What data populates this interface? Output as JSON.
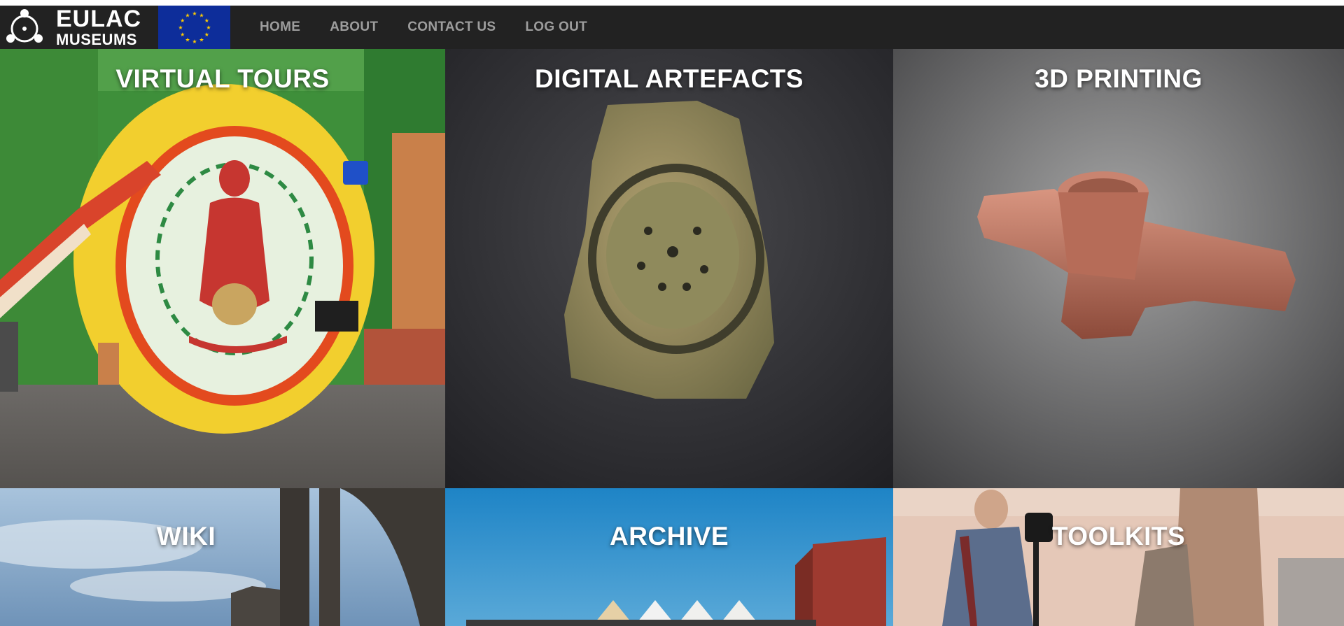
{
  "brand": {
    "line1": "EULAC",
    "line2": "MUSEUMS"
  },
  "nav": {
    "items": [
      {
        "label": "HOME"
      },
      {
        "label": "ABOUT"
      },
      {
        "label": "CONTACT US"
      },
      {
        "label": "LOG OUT"
      }
    ]
  },
  "tiles": [
    {
      "title": "VIRTUAL TOURS",
      "image": "mural-painting-image"
    },
    {
      "title": "DIGITAL ARTEFACTS",
      "image": "carved-stone-artefact-image"
    },
    {
      "title": "3D PRINTING",
      "image": "clay-pipe-3d-model-image"
    },
    {
      "title": "WIKI",
      "image": "cathedral-ruins-image"
    },
    {
      "title": "ARCHIVE",
      "image": "buildings-blue-sky-image"
    },
    {
      "title": "TOOLKITS",
      "image": "person-with-camera-image"
    }
  ],
  "colors": {
    "navbar": "#222222",
    "nav_link": "#9d9d9d",
    "eu_blue": "#0d2d9a",
    "eu_star": "#ffcc00"
  }
}
